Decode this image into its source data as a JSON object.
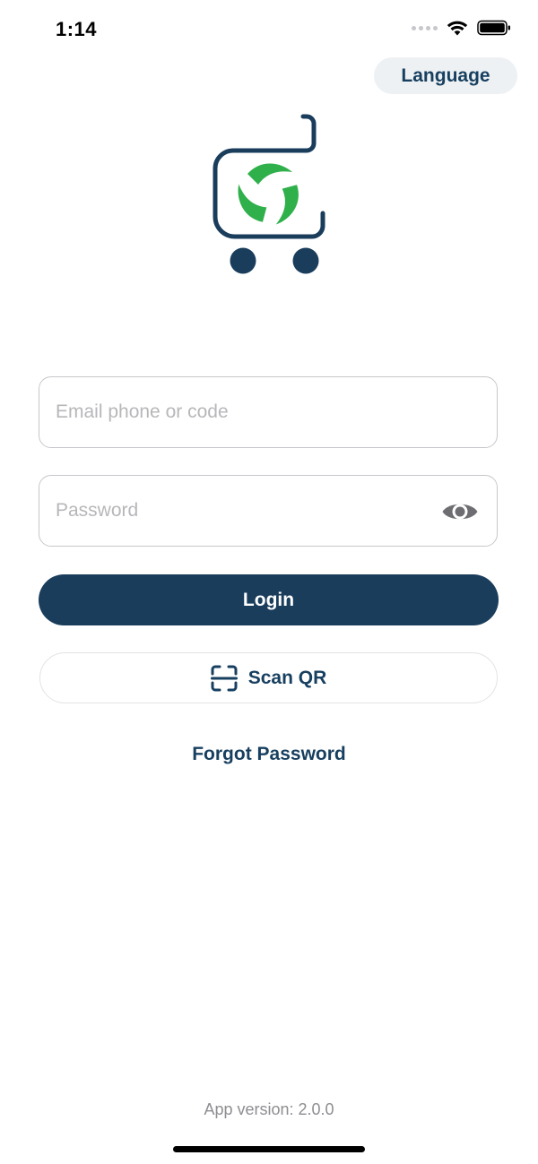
{
  "status_bar": {
    "time": "1:14"
  },
  "header": {
    "language_label": "Language"
  },
  "brand": {
    "logo_icon": "shopping-cart-logo",
    "colors": {
      "navy": "#1a3d5c",
      "green": "#2fb04b"
    }
  },
  "form": {
    "email_placeholder": "Email phone or code",
    "email_value": "",
    "password_placeholder": "Password",
    "password_value": "",
    "password_toggle_icon": "eye-icon",
    "login_label": "Login",
    "scan_label": "Scan QR",
    "scan_icon": "qr-scan-icon",
    "forgot_label": "Forgot Password"
  },
  "footer": {
    "version_text": "App version: 2.0.0"
  }
}
